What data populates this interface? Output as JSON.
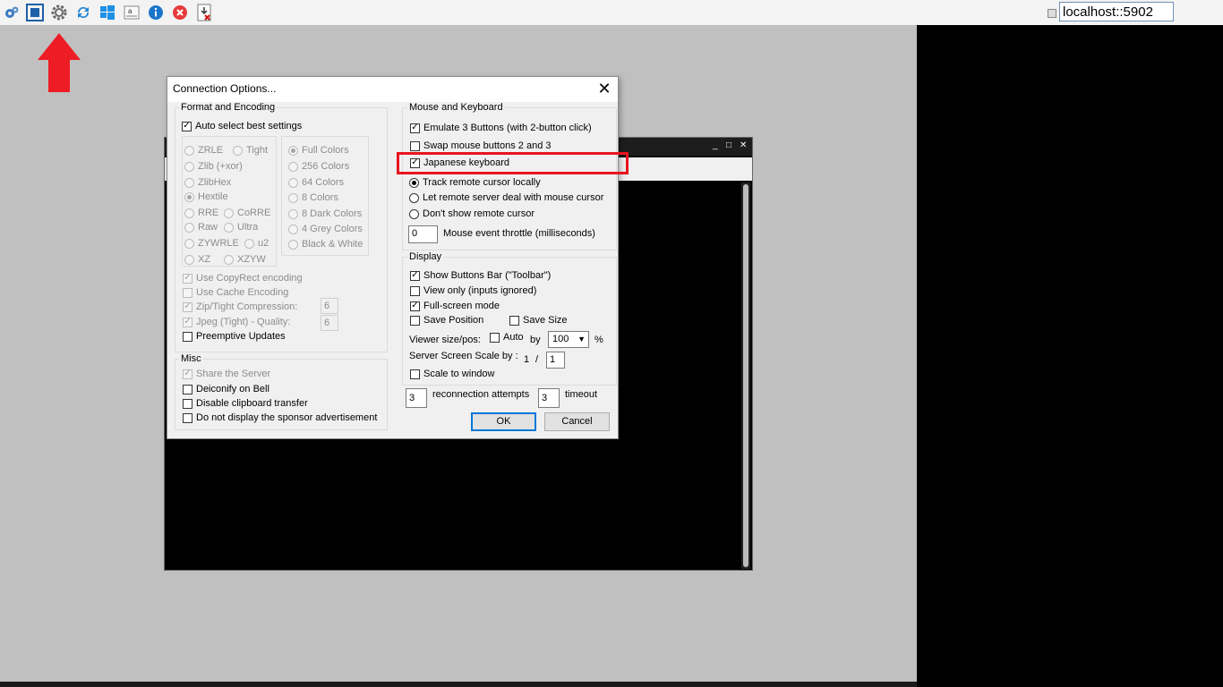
{
  "topbar": {
    "icons": [
      "options-gear-icon",
      "fullscreen-icon",
      "settings-gear-icon",
      "refresh-icon",
      "windows-key-icon",
      "ctrl-alt-del-icon",
      "info-icon",
      "close-icon",
      "transfer-icon"
    ],
    "server": "localhost::5902"
  },
  "dialog": {
    "title": "Connection Options...",
    "close": "✕",
    "format": {
      "group_label": "Format and Encoding",
      "auto_select": "Auto select best settings",
      "encodings": [
        "ZRLE",
        "Tight",
        "Zlib (+xor)",
        "ZlibHex",
        "Hextile",
        "RRE",
        "CoRRE",
        "Raw",
        "Ultra",
        "ZYWRLE",
        "u2",
        "XZ",
        "XZYW"
      ],
      "colors": [
        "Full Colors",
        "256 Colors",
        "64 Colors",
        "8 Colors",
        "8 Dark Colors",
        "4 Grey Colors",
        "Black & White"
      ],
      "copyrect": "Use CopyRect encoding",
      "cache": "Use Cache Encoding",
      "zip": "Zip/Tight Compression:",
      "zip_value": "6",
      "jpeg": "Jpeg (Tight) - Quality:",
      "jpeg_value": "6",
      "preemptive": "Preemptive Updates"
    },
    "misc": {
      "group_label": "Misc",
      "share": "Share the Server",
      "deiconify": "Deiconify on Bell",
      "clipboard": "Disable clipboard transfer",
      "sponsor": "Do not display the sponsor advertisement"
    },
    "mouse": {
      "group_label": "Mouse and Keyboard",
      "emulate": "Emulate 3 Buttons (with 2-button click)",
      "swap": "Swap mouse buttons 2 and 3",
      "japanese": "Japanese keyboard",
      "track_local": "Track remote cursor locally",
      "let_remote": "Let remote server deal with mouse cursor",
      "dont_show": "Don't show remote cursor",
      "throttle_value": "0",
      "throttle_label": "Mouse event throttle (milliseconds)"
    },
    "display": {
      "group_label": "Display",
      "toolbar": "Show Buttons Bar (\"Toolbar\")",
      "viewonly": "View only (inputs ignored)",
      "fullscreen": "Full-screen mode",
      "save_position": "Save Position",
      "save_size": "Save Size",
      "viewer_size": "Viewer size/pos:",
      "auto": "Auto",
      "by": "by",
      "scale_value": "100",
      "percent": "%",
      "server_scale": "Server Screen Scale by :",
      "scale_num": "1",
      "slash": "/",
      "scale_den": "1",
      "scale_window": "Scale to window"
    },
    "reconnect": {
      "attempts_value": "3",
      "attempts_label": "reconnection attempts",
      "timeout_value": "3",
      "timeout_label": "timeout"
    },
    "ok": "OK",
    "cancel": "Cancel"
  },
  "vnc_window": {
    "controls": [
      "_",
      "□",
      "✕"
    ]
  }
}
